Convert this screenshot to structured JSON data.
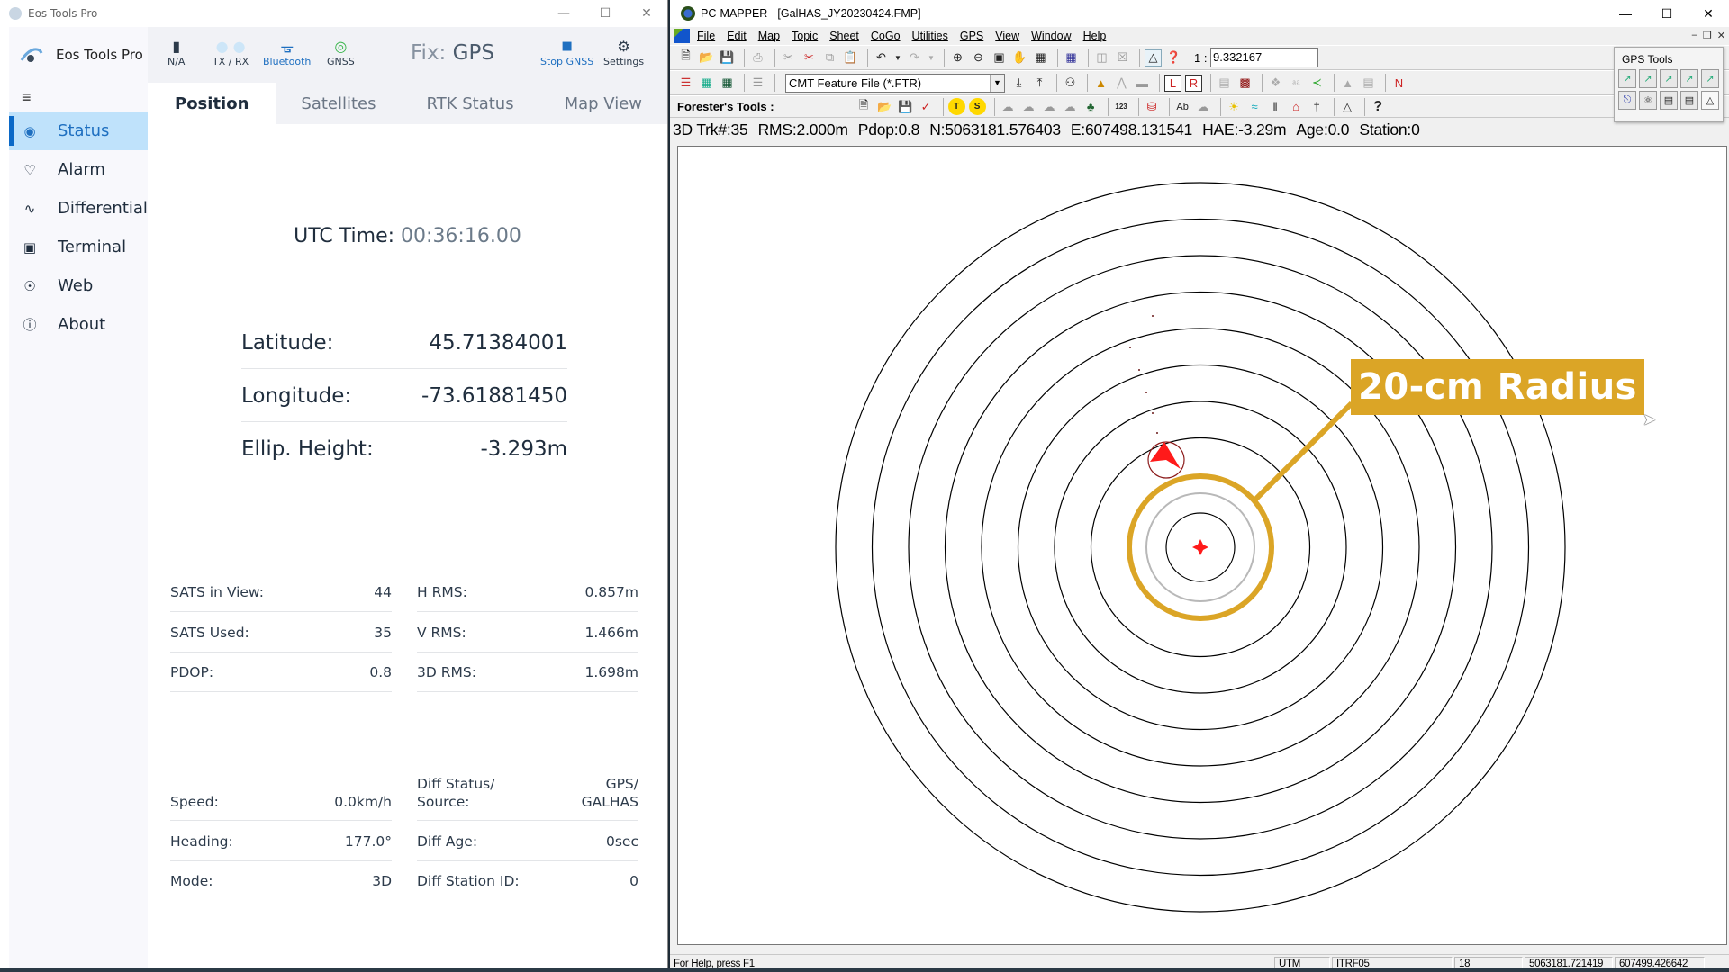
{
  "eos": {
    "window_title": "Eos Tools Pro",
    "brand": "Eos Tools Pro",
    "window_controls": [
      "minimize",
      "maximize",
      "close"
    ],
    "toolbar": {
      "battery_label": "N/A",
      "txrx_label": "TX / RX",
      "bluetooth_label": "Bluetooth",
      "gnss_label": "GNSS",
      "fix_prefix": "Fix:",
      "fix_value": "GPS",
      "stop_label": "Stop GNSS",
      "settings_label": "Settings"
    },
    "sidebar": {
      "items": [
        {
          "label": "Status",
          "icon": "globe-icon",
          "active": true
        },
        {
          "label": "Alarm",
          "icon": "bell-icon"
        },
        {
          "label": "Differential",
          "icon": "chart-icon"
        },
        {
          "label": "Terminal",
          "icon": "terminal-icon"
        },
        {
          "label": "Web",
          "icon": "web-icon"
        },
        {
          "label": "About",
          "icon": "info-icon"
        }
      ]
    },
    "tabs": [
      "Position",
      "Satellites",
      "RTK Status",
      "Map View"
    ],
    "active_tab": "Position",
    "utc_label": "UTC Time:",
    "utc_value": "00:36:16.00",
    "position": [
      {
        "label": "Latitude:",
        "value": "45.71384001"
      },
      {
        "label": "Longitude:",
        "value": "-73.61881450"
      },
      {
        "label": "Ellip. Height:",
        "value": "-3.293m"
      }
    ],
    "stats_left_a": [
      {
        "label": "SATS in View:",
        "value": "44"
      },
      {
        "label": "SATS Used:",
        "value": "35"
      },
      {
        "label": "PDOP:",
        "value": "0.8"
      }
    ],
    "stats_right_a": [
      {
        "label": "H RMS:",
        "value": "0.857m"
      },
      {
        "label": "V RMS:",
        "value": "1.466m"
      },
      {
        "label": "3D RMS:",
        "value": "1.698m"
      }
    ],
    "stats_left_b": [
      {
        "label": "Speed:",
        "value": "0.0km/h"
      },
      {
        "label": "Heading:",
        "value": "177.0°"
      },
      {
        "label": "Mode:",
        "value": "3D"
      }
    ],
    "stats_right_b": [
      {
        "label": "Diff Status/\nSource:",
        "value": "GPS/\nGALHAS"
      },
      {
        "label": "Diff Age:",
        "value": "0sec"
      },
      {
        "label": "Diff Station ID:",
        "value": "0"
      }
    ]
  },
  "pcm": {
    "window_title": "PC-MAPPER - [GalHAS_JY20230424.FMP]",
    "menu": [
      "File",
      "Edit",
      "Map",
      "Topic",
      "Sheet",
      "CoGo",
      "Utilities",
      "GPS",
      "View",
      "Window",
      "Help"
    ],
    "scale_prefix": "1 :",
    "scale_value": "9.332167",
    "feature_file": "CMT Feature File (*.FTR)",
    "forester_label": "Forester's Tools :",
    "gps_tools_title": "GPS Tools",
    "gps_status": [
      "3D Trk#:35",
      "RMS:2.000m",
      "Pdop:0.8",
      "N:5063181.576403",
      "E:607498.131541",
      "HAE:-3.29m",
      "Age:0.0",
      "Station:0"
    ],
    "statusbar": {
      "help": "For Help, press F1",
      "projection": "UTM",
      "datum": "ITRF05",
      "zone": "18",
      "northing": "5063181.721419",
      "easting": "607499.426642"
    },
    "callout": "20-cm Radius",
    "colors": {
      "highlight": "#dba526",
      "marker": "#ff1a1a"
    }
  }
}
